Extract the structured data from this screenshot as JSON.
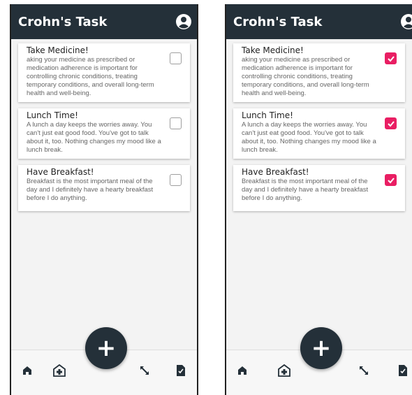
{
  "screens": [
    {
      "app_title": "Crohn's Task",
      "tasks": [
        {
          "title": "Take Medicine!",
          "description": "aking your medicine as prescribed or medication adherence is important for controlling chronic conditions, treating temporary conditions, and overall long-term health and well-being.",
          "checked": false
        },
        {
          "title": "Lunch Time!",
          "description": "A lunch a day keeps the worries away. You can't just eat good food. You've got to talk about it, too. Nothing changes my mood like a lunch break.",
          "checked": false
        },
        {
          "title": "Have Breakfast!",
          "description": "Breakfast is the most important meal of the day and I definitely have a hearty breakfast before I do anything.",
          "checked": false
        }
      ],
      "fab_label": "+"
    },
    {
      "app_title": "Crohn's Task",
      "tasks": [
        {
          "title": "Take Medicine!",
          "description": "aking your medicine as prescribed or medication adherence is important for controlling chronic conditions, treating temporary conditions, and overall long-term health and well-being.",
          "checked": true
        },
        {
          "title": "Lunch Time!",
          "description": "A lunch a day keeps the worries away. You can't just eat good food. You've got to talk about it, too. Nothing changes my mood like a lunch break.",
          "checked": true
        },
        {
          "title": "Have Breakfast!",
          "description": "Breakfast is the most important meal of the day and I definitely have a hearty breakfast before I do anything.",
          "checked": true
        }
      ],
      "fab_label": "+"
    }
  ],
  "nav_icons": [
    "home-icon",
    "hospital-icon",
    "expand-arrows-icon",
    "document-check-icon"
  ],
  "colors": {
    "appbar": "#243039",
    "accent": "#e91e63",
    "fab": "#243039"
  }
}
